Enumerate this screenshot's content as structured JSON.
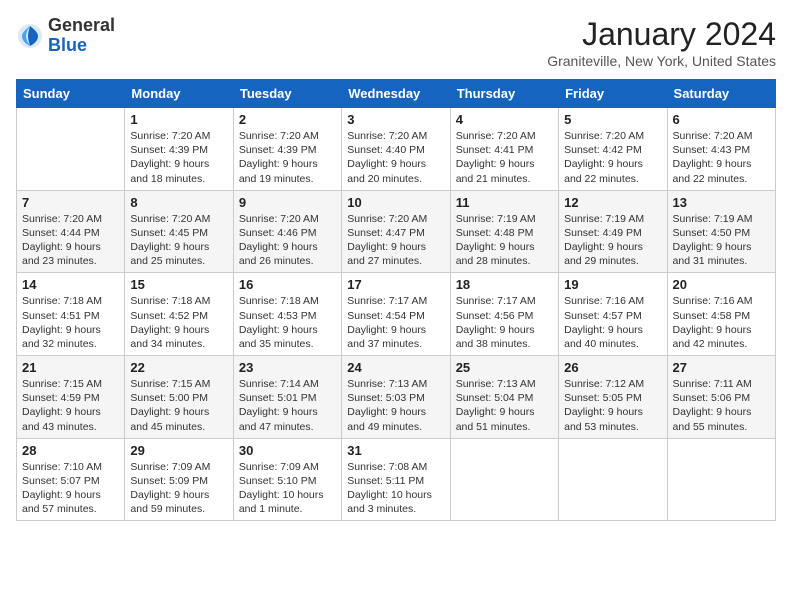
{
  "header": {
    "logo_general": "General",
    "logo_blue": "Blue",
    "month_year": "January 2024",
    "location": "Graniteville, New York, United States"
  },
  "days_of_week": [
    "Sunday",
    "Monday",
    "Tuesday",
    "Wednesday",
    "Thursday",
    "Friday",
    "Saturday"
  ],
  "weeks": [
    [
      {
        "day": "",
        "content": ""
      },
      {
        "day": "1",
        "content": "Sunrise: 7:20 AM\nSunset: 4:39 PM\nDaylight: 9 hours\nand 18 minutes."
      },
      {
        "day": "2",
        "content": "Sunrise: 7:20 AM\nSunset: 4:39 PM\nDaylight: 9 hours\nand 19 minutes."
      },
      {
        "day": "3",
        "content": "Sunrise: 7:20 AM\nSunset: 4:40 PM\nDaylight: 9 hours\nand 20 minutes."
      },
      {
        "day": "4",
        "content": "Sunrise: 7:20 AM\nSunset: 4:41 PM\nDaylight: 9 hours\nand 21 minutes."
      },
      {
        "day": "5",
        "content": "Sunrise: 7:20 AM\nSunset: 4:42 PM\nDaylight: 9 hours\nand 22 minutes."
      },
      {
        "day": "6",
        "content": "Sunrise: 7:20 AM\nSunset: 4:43 PM\nDaylight: 9 hours\nand 22 minutes."
      }
    ],
    [
      {
        "day": "7",
        "content": "Sunrise: 7:20 AM\nSunset: 4:44 PM\nDaylight: 9 hours\nand 23 minutes."
      },
      {
        "day": "8",
        "content": "Sunrise: 7:20 AM\nSunset: 4:45 PM\nDaylight: 9 hours\nand 25 minutes."
      },
      {
        "day": "9",
        "content": "Sunrise: 7:20 AM\nSunset: 4:46 PM\nDaylight: 9 hours\nand 26 minutes."
      },
      {
        "day": "10",
        "content": "Sunrise: 7:20 AM\nSunset: 4:47 PM\nDaylight: 9 hours\nand 27 minutes."
      },
      {
        "day": "11",
        "content": "Sunrise: 7:19 AM\nSunset: 4:48 PM\nDaylight: 9 hours\nand 28 minutes."
      },
      {
        "day": "12",
        "content": "Sunrise: 7:19 AM\nSunset: 4:49 PM\nDaylight: 9 hours\nand 29 minutes."
      },
      {
        "day": "13",
        "content": "Sunrise: 7:19 AM\nSunset: 4:50 PM\nDaylight: 9 hours\nand 31 minutes."
      }
    ],
    [
      {
        "day": "14",
        "content": "Sunrise: 7:18 AM\nSunset: 4:51 PM\nDaylight: 9 hours\nand 32 minutes."
      },
      {
        "day": "15",
        "content": "Sunrise: 7:18 AM\nSunset: 4:52 PM\nDaylight: 9 hours\nand 34 minutes."
      },
      {
        "day": "16",
        "content": "Sunrise: 7:18 AM\nSunset: 4:53 PM\nDaylight: 9 hours\nand 35 minutes."
      },
      {
        "day": "17",
        "content": "Sunrise: 7:17 AM\nSunset: 4:54 PM\nDaylight: 9 hours\nand 37 minutes."
      },
      {
        "day": "18",
        "content": "Sunrise: 7:17 AM\nSunset: 4:56 PM\nDaylight: 9 hours\nand 38 minutes."
      },
      {
        "day": "19",
        "content": "Sunrise: 7:16 AM\nSunset: 4:57 PM\nDaylight: 9 hours\nand 40 minutes."
      },
      {
        "day": "20",
        "content": "Sunrise: 7:16 AM\nSunset: 4:58 PM\nDaylight: 9 hours\nand 42 minutes."
      }
    ],
    [
      {
        "day": "21",
        "content": "Sunrise: 7:15 AM\nSunset: 4:59 PM\nDaylight: 9 hours\nand 43 minutes."
      },
      {
        "day": "22",
        "content": "Sunrise: 7:15 AM\nSunset: 5:00 PM\nDaylight: 9 hours\nand 45 minutes."
      },
      {
        "day": "23",
        "content": "Sunrise: 7:14 AM\nSunset: 5:01 PM\nDaylight: 9 hours\nand 47 minutes."
      },
      {
        "day": "24",
        "content": "Sunrise: 7:13 AM\nSunset: 5:03 PM\nDaylight: 9 hours\nand 49 minutes."
      },
      {
        "day": "25",
        "content": "Sunrise: 7:13 AM\nSunset: 5:04 PM\nDaylight: 9 hours\nand 51 minutes."
      },
      {
        "day": "26",
        "content": "Sunrise: 7:12 AM\nSunset: 5:05 PM\nDaylight: 9 hours\nand 53 minutes."
      },
      {
        "day": "27",
        "content": "Sunrise: 7:11 AM\nSunset: 5:06 PM\nDaylight: 9 hours\nand 55 minutes."
      }
    ],
    [
      {
        "day": "28",
        "content": "Sunrise: 7:10 AM\nSunset: 5:07 PM\nDaylight: 9 hours\nand 57 minutes."
      },
      {
        "day": "29",
        "content": "Sunrise: 7:09 AM\nSunset: 5:09 PM\nDaylight: 9 hours\nand 59 minutes."
      },
      {
        "day": "30",
        "content": "Sunrise: 7:09 AM\nSunset: 5:10 PM\nDaylight: 10 hours\nand 1 minute."
      },
      {
        "day": "31",
        "content": "Sunrise: 7:08 AM\nSunset: 5:11 PM\nDaylight: 10 hours\nand 3 minutes."
      },
      {
        "day": "",
        "content": ""
      },
      {
        "day": "",
        "content": ""
      },
      {
        "day": "",
        "content": ""
      }
    ]
  ]
}
